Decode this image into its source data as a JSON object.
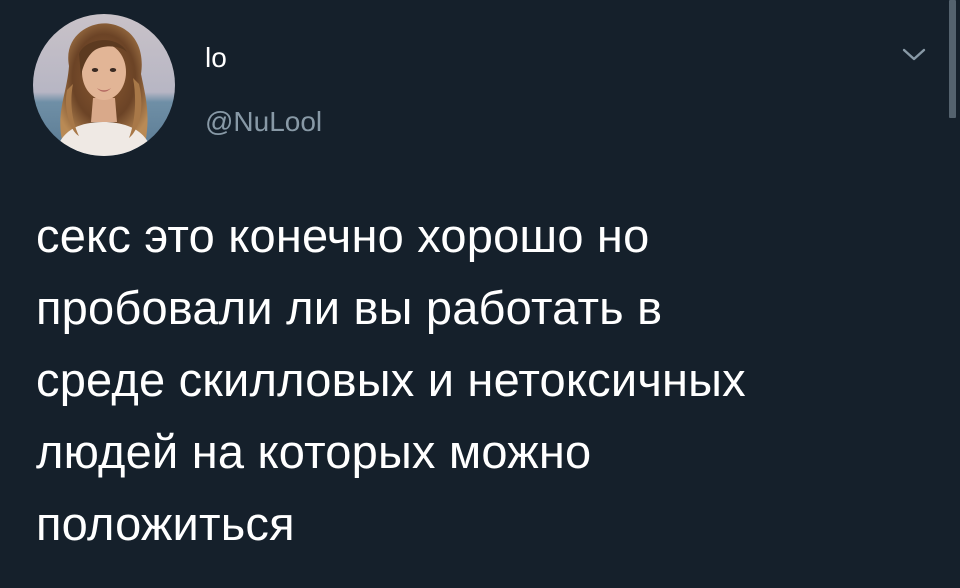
{
  "author": {
    "display_name": "lo",
    "handle": "@NuLool",
    "avatar_icon": "profile-photo"
  },
  "menu": {
    "icon": "chevron-down-icon"
  },
  "tweet": {
    "lines": [
      "секс это конечно хорошо но",
      "пробовали ли вы работать в",
      "среде скилловых и нетоксичных",
      "людей на которых можно",
      "положиться"
    ]
  },
  "colors": {
    "background": "#15202b",
    "text": "#ffffff",
    "secondary_text": "#8899a6"
  }
}
